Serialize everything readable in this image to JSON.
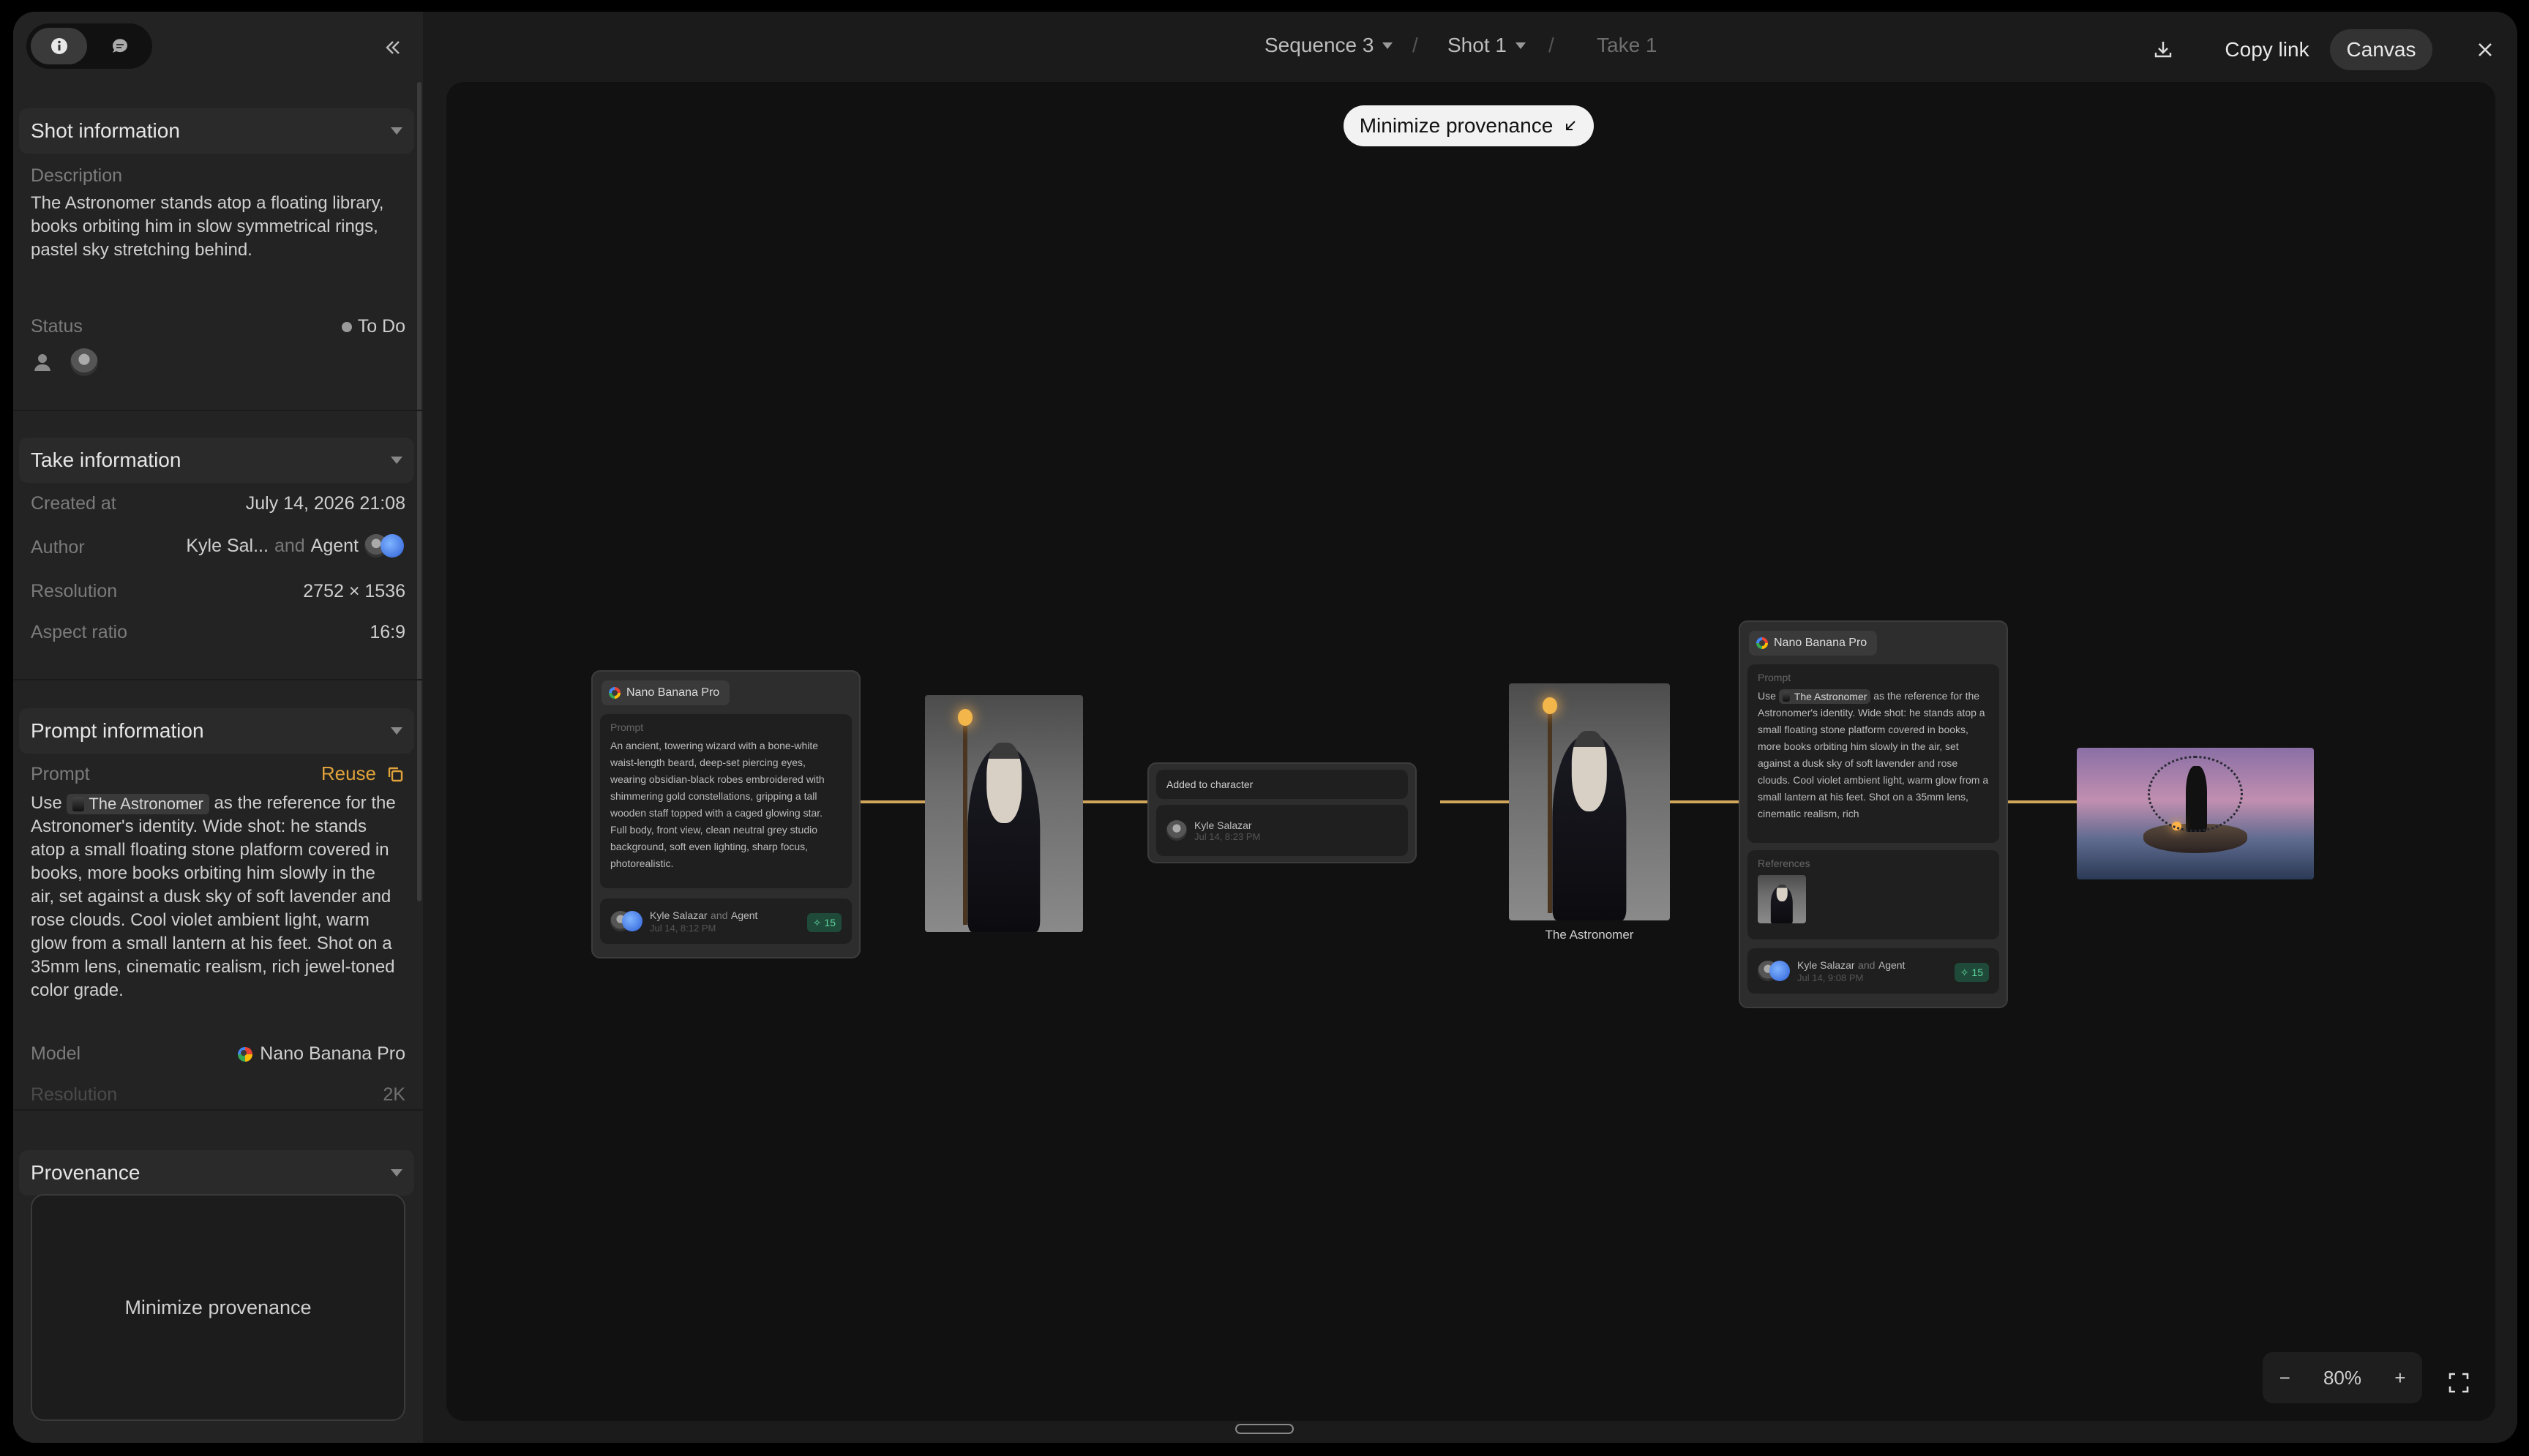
{
  "sidebar": {
    "shot_info": {
      "title": "Shot information",
      "description_label": "Description",
      "description": "The Astronomer stands atop a floating library, books orbiting him in slow symmetrical rings, pastel sky stretching behind.",
      "status_label": "Status",
      "status_value": "To Do"
    },
    "take_info": {
      "title": "Take information",
      "created_label": "Created at",
      "created_value": "July 14, 2026 21:08",
      "author_label": "Author",
      "author_name": "Kyle Sal...",
      "author_and": "and",
      "author_agent": "Agent",
      "resolution_label": "Resolution",
      "resolution_value": "2752 × 1536",
      "aspect_label": "Aspect ratio",
      "aspect_value": "16:9"
    },
    "prompt_info": {
      "title": "Prompt information",
      "prompt_label": "Prompt",
      "reuse_label": "Reuse",
      "prompt_pre": "Use",
      "prompt_chip": "The Astronomer",
      "prompt_post": "as the reference for the Astronomer's identity. Wide shot: he stands atop a small floating stone platform covered in books, more books orbiting him slowly in the air, set against a dusk sky of soft lavender and rose clouds. Cool violet ambient light, warm glow from a small lantern at his feet. Shot on a 35mm lens, cinematic realism, rich jewel-toned color grade.",
      "model_label": "Model",
      "model_value": "Nano Banana Pro",
      "resolution_label": "Resolution",
      "resolution_value": "2K"
    },
    "provenance": {
      "title": "Provenance",
      "box_text": "Minimize provenance"
    }
  },
  "topbar": {
    "sequence": "Sequence 3",
    "shot": "Shot 1",
    "take": "Take 1",
    "slash": "/",
    "copy_link": "Copy link",
    "canvas": "Canvas"
  },
  "canvas": {
    "minimize_label": "Minimize provenance",
    "node1": {
      "model": "Nano Banana Pro",
      "prompt_label": "Prompt",
      "prompt": "An ancient, towering wizard with a bone-white waist-length beard, deep-set piercing eyes, wearing obsidian-black robes embroidered with shimmering gold constellations, gripping a tall wooden staff topped with a caged glowing star. Full body, front view, clean neutral grey studio background, soft even lighting, sharp focus, photorealistic.",
      "author": "Kyle Salazar",
      "and": "and",
      "agent": "Agent",
      "date": "Jul 14, 8:12 PM",
      "badge": "15"
    },
    "node2": {
      "title": "Added to character",
      "author": "Kyle Salazar",
      "date": "Jul 14, 8:23 PM"
    },
    "character_caption": "The Astronomer",
    "node3": {
      "model": "Nano Banana Pro",
      "prompt_label": "Prompt",
      "prompt_pre": "Use",
      "prompt_chip": "The Astronomer",
      "prompt_post": "as the reference for the Astronomer's identity. Wide shot: he stands atop a small floating stone platform covered in books, more books orbiting him slowly in the air, set against a dusk sky of soft lavender and rose clouds. Cool violet ambient light, warm glow from a small lantern at his feet. Shot on a 35mm lens, cinematic realism, rich",
      "references_label": "References",
      "author": "Kyle Salazar",
      "and": "and",
      "agent": "Agent",
      "date": "Jul 14, 9:08 PM",
      "badge": "15"
    },
    "zoom": {
      "minus": "−",
      "value": "80%",
      "plus": "+"
    }
  },
  "colors": {
    "accent_orange": "#e0a23a",
    "wire": "#d1a55a",
    "badge_green": "#5fd39d"
  }
}
